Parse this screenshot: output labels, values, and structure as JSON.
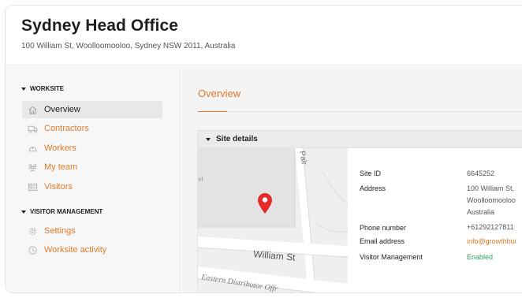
{
  "header": {
    "title": "Sydney Head Office",
    "subtitle": "100 William St, Woolloomooloo, Sydney NSW 2011, Australia"
  },
  "sidebar": {
    "sections": [
      {
        "label": "WORKSITE",
        "items": [
          {
            "label": "Overview",
            "icon": "home-icon",
            "active": true
          },
          {
            "label": "Contractors",
            "icon": "truck-icon",
            "active": false
          },
          {
            "label": "Workers",
            "icon": "hard-hat-icon",
            "active": false
          },
          {
            "label": "My team",
            "icon": "team-icon",
            "active": false
          },
          {
            "label": "Visitors",
            "icon": "id-card-icon",
            "active": false
          }
        ]
      },
      {
        "label": "VISITOR MANAGEMENT",
        "items": [
          {
            "label": "Settings",
            "icon": "gear-icon",
            "active": false
          },
          {
            "label": "Worksite activity",
            "icon": "clock-icon",
            "active": false
          }
        ]
      }
    ]
  },
  "main": {
    "tab": "Overview",
    "panel": {
      "title": "Site details",
      "map": {
        "street_labels": [
          "William St",
          "Eastern Distributor Offr",
          "Palr",
          "tel"
        ]
      },
      "details": [
        {
          "key": "Site ID",
          "value": "6645252"
        },
        {
          "key": "Address",
          "value_lines": [
            "100 William St,",
            "Woolloomooloo",
            "Australia"
          ]
        },
        {
          "key": "Phone number",
          "value": "+61292127811"
        },
        {
          "key": "Email address",
          "value": "info@growthbui"
        },
        {
          "key": "Visitor Management",
          "value": "Enabled"
        }
      ]
    }
  },
  "colors": {
    "accent": "#e07a2a",
    "enabled": "#2f9e5a",
    "map_pin": "#e52a2a"
  }
}
